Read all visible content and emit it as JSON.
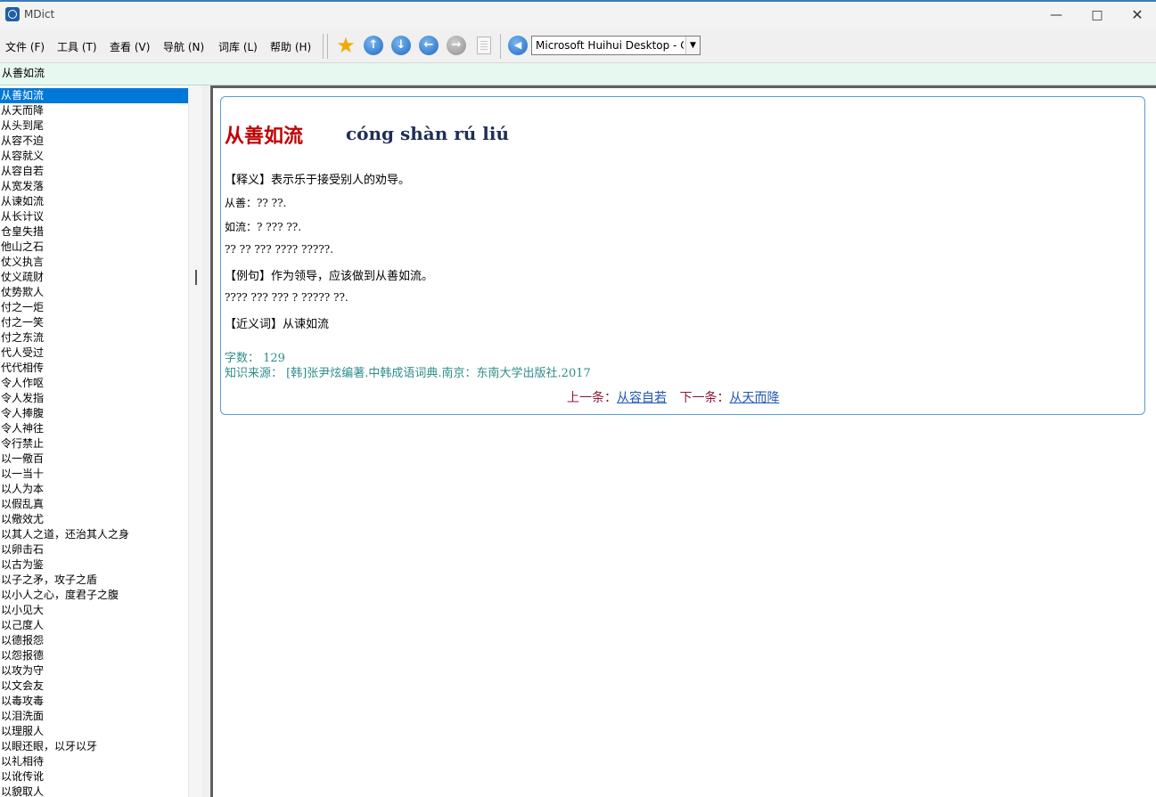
{
  "window": {
    "title": "MDict",
    "minimize_icon": "minimize-icon",
    "maximize_icon": "maximize-icon",
    "close_icon": "close-icon"
  },
  "menu": [
    {
      "label": "文件 (F)"
    },
    {
      "label": "工具 (T)"
    },
    {
      "label": "查看 (V)"
    },
    {
      "label": "导航 (N)"
    },
    {
      "label": "词库 (L)"
    },
    {
      "label": "帮助 (H)"
    }
  ],
  "toolbar": {
    "icons": [
      "favorite-star-icon",
      "arrow-up-icon",
      "arrow-down-icon",
      "arrow-left-icon",
      "arrow-right-icon",
      "clipboard-icon",
      "speaker-icon"
    ],
    "font_select_value": "Microsoft Huihui Desktop - Chinese"
  },
  "search": {
    "value": "从善如流"
  },
  "word_list": {
    "selected_index": 0,
    "items": [
      "从善如流",
      "从天而降",
      "从头到尾",
      "从容不迫",
      "从容就义",
      "从容自若",
      "从宽发落",
      "从谏如流",
      "从长计议",
      "仓皇失措",
      "他山之石",
      "仗义执言",
      "仗义疏财",
      "仗势欺人",
      "付之一炬",
      "付之一笑",
      "付之东流",
      "代人受过",
      "代代相传",
      "令人作呕",
      "令人发指",
      "令人捧腹",
      "令人神往",
      "令行禁止",
      "以一儆百",
      "以一当十",
      "以人为本",
      "以假乱真",
      "以儆效尤",
      "以其人之道，还治其人之身",
      "以卵击石",
      "以古为鉴",
      "以子之矛，攻子之盾",
      "以小人之心，度君子之腹",
      "以小见大",
      "以己度人",
      "以德报怨",
      "以怨报德",
      "以攻为守",
      "以文会友",
      "以毒攻毒",
      "以泪洗面",
      "以理服人",
      "以眼还眼，以牙以牙",
      "以礼相待",
      "以讹传讹",
      "以貌取人"
    ]
  },
  "entry": {
    "headword": "从善如流",
    "pinyin": "cóng shàn rú liú",
    "lines": [
      "【释义】表示乐于接受别人的劝导。",
      "从善：?? ??.",
      "如流：? ??? ??.",
      "?? ?? ??? ???? ?????.",
      "【例句】作为领导，应该做到从善如流。",
      "???? ??? ??? ? ????? ??.",
      "【近义词】从谏如流"
    ],
    "char_count": "字数：  129",
    "source": "知识来源：  [韩]张尹炫编著.中韩成语词典.南京：东南大学出版社.2017",
    "prev_label": "上一条：",
    "prev_link": "从容自若",
    "next_label": "下一条：",
    "next_link": "从天而降"
  }
}
